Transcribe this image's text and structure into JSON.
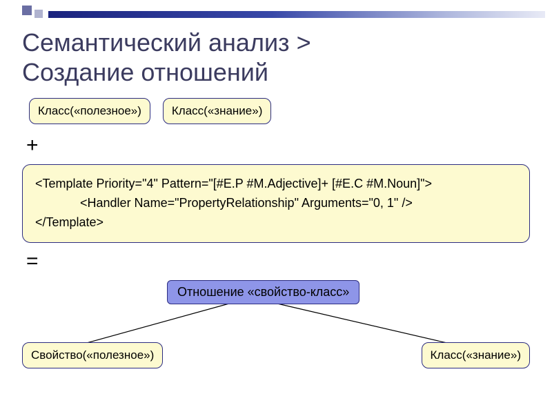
{
  "title_line1": "Семантический анализ >",
  "title_line2": "Создание отношений",
  "class_box1": "Класс(«полезное»)",
  "class_box2": "Класс(«знание»)",
  "plus": "+",
  "code_line1": "<Template Priority=\"4\" Pattern=\"[#E.P #M.Adjective]+ [#E.C #M.Noun]\">",
  "code_line2": "             <Handler Name=\"PropertyRelationship\" Arguments=\"0, 1\" />",
  "code_line3": "</Template>",
  "equals": "=",
  "relation_box": "Отношение «свойство-класс»",
  "result_left": "Свойство(«полезное»)",
  "result_right": "Класс(«знание»)"
}
